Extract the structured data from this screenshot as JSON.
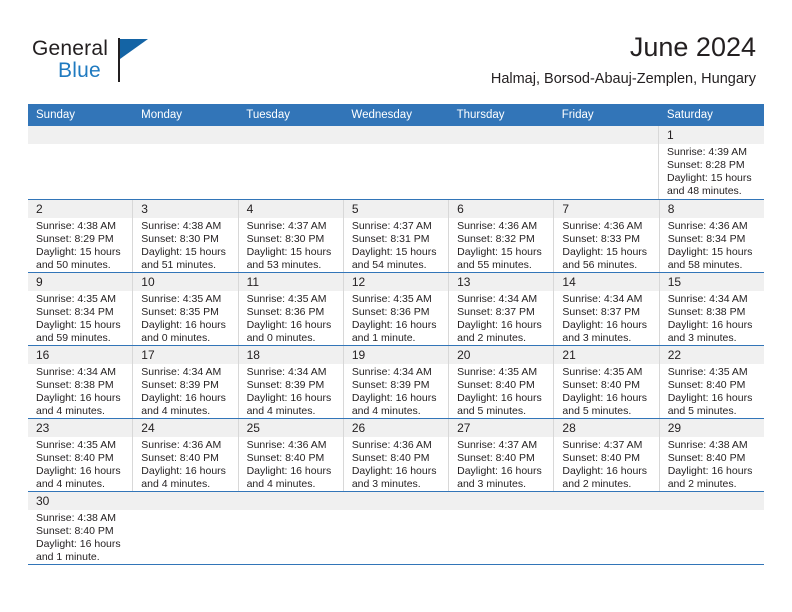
{
  "brand": {
    "name_part1": "General",
    "name_part2": "Blue",
    "flag_color": "#1464a5",
    "blue_text_color": "#1f7ac0"
  },
  "header": {
    "title": "June 2024",
    "subtitle": "Halmaj, Borsod-Abauj-Zemplen, Hungary",
    "accent_color": "#3275b8",
    "dateband_color": "#f0f0f0"
  },
  "weekdays": [
    "Sunday",
    "Monday",
    "Tuesday",
    "Wednesday",
    "Thursday",
    "Friday",
    "Saturday"
  ],
  "weeks": [
    [
      {
        "day": "",
        "lines": []
      },
      {
        "day": "",
        "lines": []
      },
      {
        "day": "",
        "lines": []
      },
      {
        "day": "",
        "lines": []
      },
      {
        "day": "",
        "lines": []
      },
      {
        "day": "",
        "lines": []
      },
      {
        "day": "1",
        "lines": [
          "Sunrise: 4:39 AM",
          "Sunset: 8:28 PM",
          "Daylight: 15 hours",
          "and 48 minutes."
        ]
      }
    ],
    [
      {
        "day": "2",
        "lines": [
          "Sunrise: 4:38 AM",
          "Sunset: 8:29 PM",
          "Daylight: 15 hours",
          "and 50 minutes."
        ]
      },
      {
        "day": "3",
        "lines": [
          "Sunrise: 4:38 AM",
          "Sunset: 8:30 PM",
          "Daylight: 15 hours",
          "and 51 minutes."
        ]
      },
      {
        "day": "4",
        "lines": [
          "Sunrise: 4:37 AM",
          "Sunset: 8:30 PM",
          "Daylight: 15 hours",
          "and 53 minutes."
        ]
      },
      {
        "day": "5",
        "lines": [
          "Sunrise: 4:37 AM",
          "Sunset: 8:31 PM",
          "Daylight: 15 hours",
          "and 54 minutes."
        ]
      },
      {
        "day": "6",
        "lines": [
          "Sunrise: 4:36 AM",
          "Sunset: 8:32 PM",
          "Daylight: 15 hours",
          "and 55 minutes."
        ]
      },
      {
        "day": "7",
        "lines": [
          "Sunrise: 4:36 AM",
          "Sunset: 8:33 PM",
          "Daylight: 15 hours",
          "and 56 minutes."
        ]
      },
      {
        "day": "8",
        "lines": [
          "Sunrise: 4:36 AM",
          "Sunset: 8:34 PM",
          "Daylight: 15 hours",
          "and 58 minutes."
        ]
      }
    ],
    [
      {
        "day": "9",
        "lines": [
          "Sunrise: 4:35 AM",
          "Sunset: 8:34 PM",
          "Daylight: 15 hours",
          "and 59 minutes."
        ]
      },
      {
        "day": "10",
        "lines": [
          "Sunrise: 4:35 AM",
          "Sunset: 8:35 PM",
          "Daylight: 16 hours",
          "and 0 minutes."
        ]
      },
      {
        "day": "11",
        "lines": [
          "Sunrise: 4:35 AM",
          "Sunset: 8:36 PM",
          "Daylight: 16 hours",
          "and 0 minutes."
        ]
      },
      {
        "day": "12",
        "lines": [
          "Sunrise: 4:35 AM",
          "Sunset: 8:36 PM",
          "Daylight: 16 hours",
          "and 1 minute."
        ]
      },
      {
        "day": "13",
        "lines": [
          "Sunrise: 4:34 AM",
          "Sunset: 8:37 PM",
          "Daylight: 16 hours",
          "and 2 minutes."
        ]
      },
      {
        "day": "14",
        "lines": [
          "Sunrise: 4:34 AM",
          "Sunset: 8:37 PM",
          "Daylight: 16 hours",
          "and 3 minutes."
        ]
      },
      {
        "day": "15",
        "lines": [
          "Sunrise: 4:34 AM",
          "Sunset: 8:38 PM",
          "Daylight: 16 hours",
          "and 3 minutes."
        ]
      }
    ],
    [
      {
        "day": "16",
        "lines": [
          "Sunrise: 4:34 AM",
          "Sunset: 8:38 PM",
          "Daylight: 16 hours",
          "and 4 minutes."
        ]
      },
      {
        "day": "17",
        "lines": [
          "Sunrise: 4:34 AM",
          "Sunset: 8:39 PM",
          "Daylight: 16 hours",
          "and 4 minutes."
        ]
      },
      {
        "day": "18",
        "lines": [
          "Sunrise: 4:34 AM",
          "Sunset: 8:39 PM",
          "Daylight: 16 hours",
          "and 4 minutes."
        ]
      },
      {
        "day": "19",
        "lines": [
          "Sunrise: 4:34 AM",
          "Sunset: 8:39 PM",
          "Daylight: 16 hours",
          "and 4 minutes."
        ]
      },
      {
        "day": "20",
        "lines": [
          "Sunrise: 4:35 AM",
          "Sunset: 8:40 PM",
          "Daylight: 16 hours",
          "and 5 minutes."
        ]
      },
      {
        "day": "21",
        "lines": [
          "Sunrise: 4:35 AM",
          "Sunset: 8:40 PM",
          "Daylight: 16 hours",
          "and 5 minutes."
        ]
      },
      {
        "day": "22",
        "lines": [
          "Sunrise: 4:35 AM",
          "Sunset: 8:40 PM",
          "Daylight: 16 hours",
          "and 5 minutes."
        ]
      }
    ],
    [
      {
        "day": "23",
        "lines": [
          "Sunrise: 4:35 AM",
          "Sunset: 8:40 PM",
          "Daylight: 16 hours",
          "and 4 minutes."
        ]
      },
      {
        "day": "24",
        "lines": [
          "Sunrise: 4:36 AM",
          "Sunset: 8:40 PM",
          "Daylight: 16 hours",
          "and 4 minutes."
        ]
      },
      {
        "day": "25",
        "lines": [
          "Sunrise: 4:36 AM",
          "Sunset: 8:40 PM",
          "Daylight: 16 hours",
          "and 4 minutes."
        ]
      },
      {
        "day": "26",
        "lines": [
          "Sunrise: 4:36 AM",
          "Sunset: 8:40 PM",
          "Daylight: 16 hours",
          "and 3 minutes."
        ]
      },
      {
        "day": "27",
        "lines": [
          "Sunrise: 4:37 AM",
          "Sunset: 8:40 PM",
          "Daylight: 16 hours",
          "and 3 minutes."
        ]
      },
      {
        "day": "28",
        "lines": [
          "Sunrise: 4:37 AM",
          "Sunset: 8:40 PM",
          "Daylight: 16 hours",
          "and 2 minutes."
        ]
      },
      {
        "day": "29",
        "lines": [
          "Sunrise: 4:38 AM",
          "Sunset: 8:40 PM",
          "Daylight: 16 hours",
          "and 2 minutes."
        ]
      }
    ],
    [
      {
        "day": "30",
        "lines": [
          "Sunrise: 4:38 AM",
          "Sunset: 8:40 PM",
          "Daylight: 16 hours",
          "and 1 minute."
        ]
      },
      {
        "day": "",
        "lines": []
      },
      {
        "day": "",
        "lines": []
      },
      {
        "day": "",
        "lines": []
      },
      {
        "day": "",
        "lines": []
      },
      {
        "day": "",
        "lines": []
      },
      {
        "day": "",
        "lines": []
      }
    ]
  ]
}
